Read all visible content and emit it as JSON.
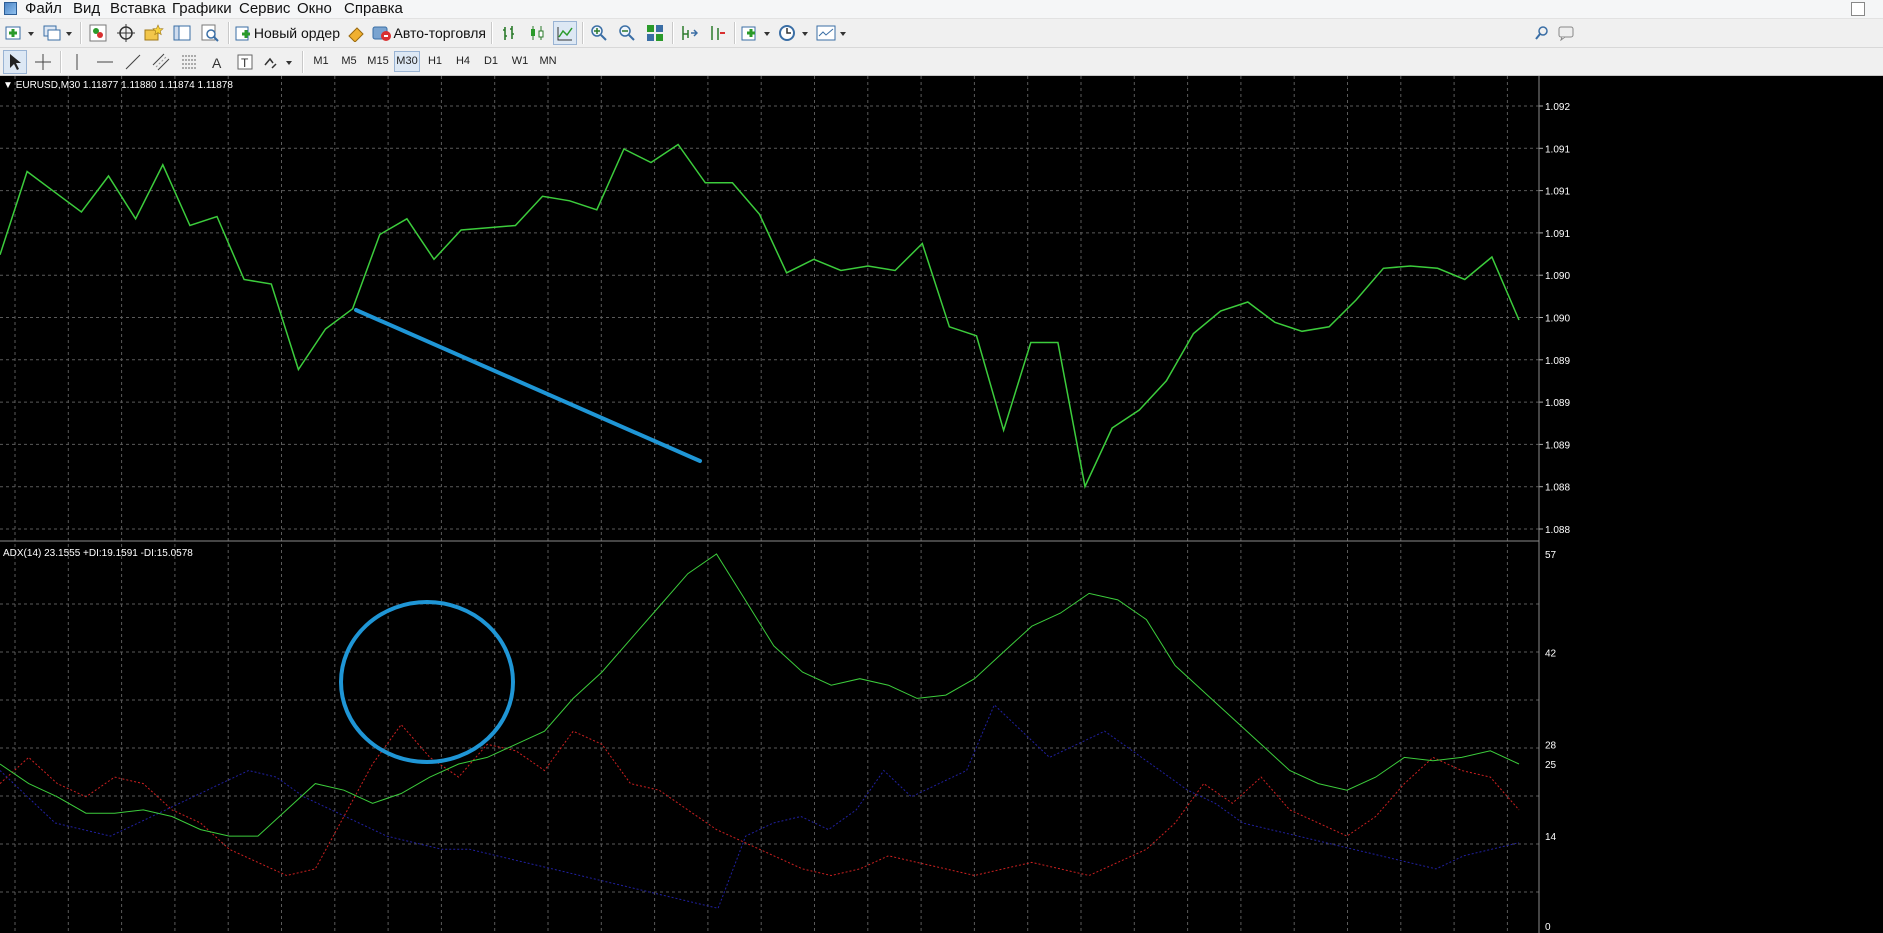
{
  "menu": [
    "Файл",
    "Вид",
    "Вставка",
    "Графики",
    "Сервис",
    "Окно",
    "Справка"
  ],
  "toolbar": {
    "new_order_label": "Новый ордер",
    "autotrading_label": "Авто-торговля"
  },
  "timeframes": [
    "M1",
    "M5",
    "M15",
    "M30",
    "H1",
    "H4",
    "D1",
    "W1",
    "MN"
  ],
  "active_timeframe": "M30",
  "chart": {
    "header": "EURUSD,M30  1.11877 1.11880 1.11874 1.11878",
    "line_color": "#3ccc3c",
    "price_ticks": [
      "1.092",
      "1.091",
      "1.091",
      "1.091",
      "1.090",
      "1.090",
      "1.089",
      "1.089",
      "1.089",
      "1.088",
      "1.088"
    ],
    "price_series_rel": [
      0.625,
      0.81,
      0.765,
      0.72,
      0.8,
      0.705,
      0.825,
      0.69,
      0.71,
      0.57,
      0.56,
      0.37,
      0.46,
      0.505,
      0.67,
      0.705,
      0.615,
      0.68,
      0.685,
      0.69,
      0.755,
      0.745,
      0.725,
      0.86,
      0.83,
      0.87,
      0.785,
      0.785,
      0.715,
      0.585,
      0.615,
      0.59,
      0.6,
      0.59,
      0.65,
      0.465,
      0.445,
      0.235,
      0.43,
      0.43,
      0.11,
      0.24,
      0.28,
      0.345,
      0.45,
      0.5,
      0.52,
      0.475,
      0.455,
      0.465,
      0.525,
      0.595,
      0.6,
      0.595,
      0.57,
      0.62,
      0.48
    ],
    "trendline_color": "#1f96d6"
  },
  "indicator": {
    "header": "ADX(14) 23.1555 +DI:19.1591 -DI:15.0578",
    "axis_ticks": [
      "57",
      "42",
      "28",
      "25",
      "14",
      "0"
    ],
    "adx_color": "#3ccc3c",
    "plus_di_color": "#cc2020",
    "minus_di_color": "#2020a0",
    "adx": [
      25,
      22,
      20,
      17.5,
      17.5,
      18,
      17,
      15,
      14,
      14,
      18,
      22,
      21,
      19,
      20.5,
      23,
      25,
      26,
      28,
      30,
      35,
      39,
      44,
      49,
      54,
      57,
      50,
      43,
      39,
      37,
      38,
      37,
      35,
      35.5,
      38,
      42,
      46,
      48,
      51,
      50,
      47,
      40,
      36,
      32,
      28,
      24,
      22,
      21,
      23,
      26,
      25.5,
      26,
      27,
      25
    ],
    "plus_di": [
      22,
      26,
      22,
      20,
      23,
      22,
      18,
      16,
      12,
      10,
      8,
      9,
      17,
      25,
      31,
      26,
      23,
      28,
      27,
      24,
      30,
      28,
      22,
      21,
      18,
      15,
      13,
      11,
      9,
      8,
      9,
      11,
      10,
      9,
      8,
      9,
      10,
      9,
      8,
      10,
      12,
      16,
      22,
      19,
      23,
      18,
      16,
      14,
      17,
      22,
      26,
      24,
      23,
      18
    ],
    "minus_di": [
      24,
      20,
      16,
      15,
      14,
      16,
      18,
      20,
      22,
      24,
      23,
      20,
      18,
      16,
      14,
      13,
      12,
      12,
      11,
      10,
      9,
      8,
      7,
      6,
      5,
      4,
      3,
      14,
      16,
      17,
      15,
      18,
      24,
      20,
      22,
      24,
      34,
      30,
      26,
      28,
      30,
      27,
      24,
      21,
      19,
      16,
      15,
      14,
      13,
      12,
      11,
      10,
      9,
      11,
      12,
      13
    ]
  }
}
